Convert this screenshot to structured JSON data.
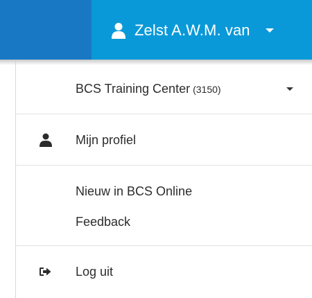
{
  "header": {
    "user_name": "Zelst A.W.M. van",
    "user_icon": "user-icon",
    "dropdown_icon": "caret-down-icon"
  },
  "menu": {
    "organization": {
      "name": "BCS Training Center",
      "number": "(3150)",
      "icon": "caret-down-icon"
    },
    "profile": {
      "label": "Mijn profiel",
      "icon": "user-icon"
    },
    "whats_new": {
      "label": "Nieuw in BCS Online"
    },
    "feedback": {
      "label": "Feedback"
    },
    "logout": {
      "label": "Log uit",
      "icon": "sign-out-icon"
    }
  },
  "colors": {
    "header_blue": "#0a99d8",
    "header_dark_blue": "#1978c4",
    "text": "#2c2c2c"
  }
}
